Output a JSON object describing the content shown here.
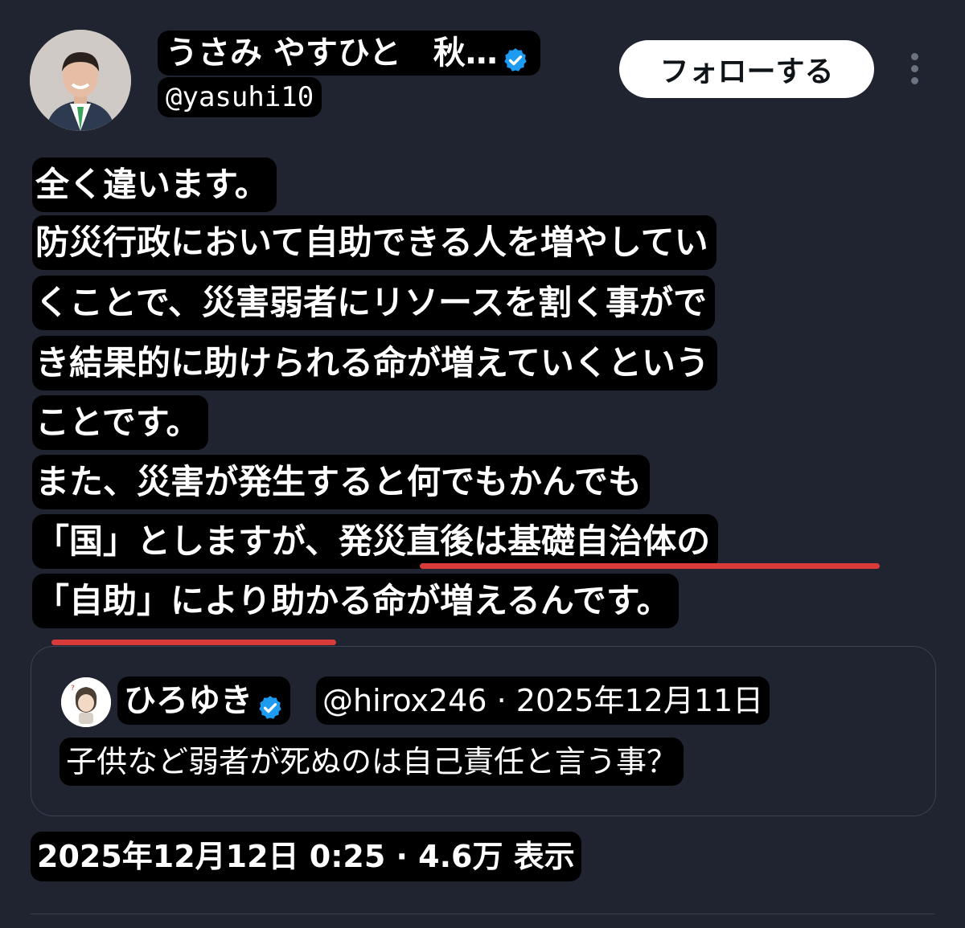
{
  "author": {
    "display_name": "うさみ やすひと　秋…",
    "handle": "@yasuhi10",
    "follow_label": "フォローする"
  },
  "tweet": {
    "lines": [
      "全く違います。",
      "防災行政において自助できる人を増やしてい",
      "くことで、災害弱者にリソースを割く事がで",
      "き結果的に助けられる命が増えていくという",
      "ことです。",
      "また、災害が発生すると何でもかんでも",
      "「国」としますが、発災直後は基礎自治体の",
      "「自助」により助かる命が増えるんです。"
    ]
  },
  "quote": {
    "name": "ひろゆき",
    "meta": "@hirox246 · 2025年12月11日",
    "text": "子供など弱者が死ぬのは自己責任と言う事？"
  },
  "footer": {
    "timestamp": "2025年12月12日 0:25 · 4.6万 表示"
  },
  "colors": {
    "background": "#1f2430",
    "verified": "#1d9bf0",
    "underline": "#d93b3b"
  }
}
